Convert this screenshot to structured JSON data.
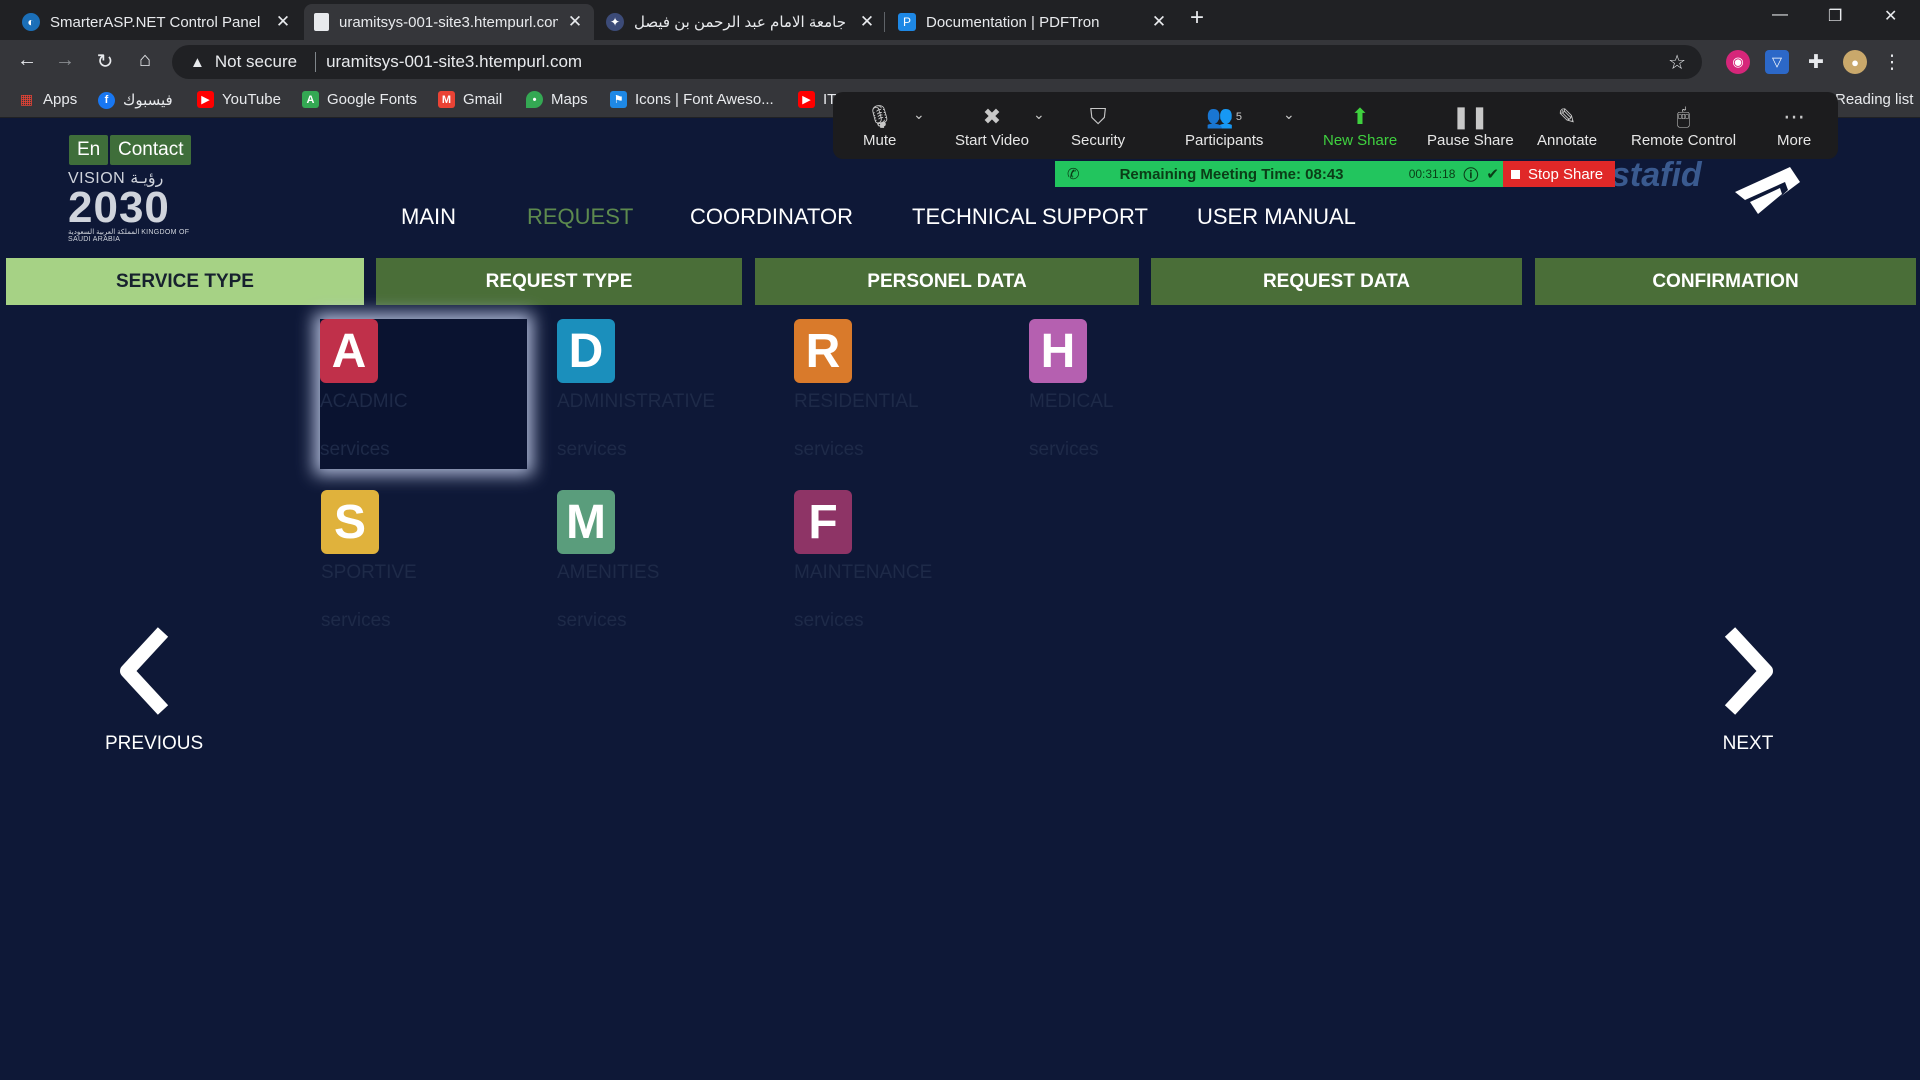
{
  "browser": {
    "tabs": [
      {
        "title": "SmarterASP.NET Control Panel",
        "active": false
      },
      {
        "title": "uramitsys-001-site3.htempurl.com",
        "active": true
      },
      {
        "title": "جامعة الامام عبد الرحمن بن فيصل",
        "active": false
      },
      {
        "title": "Documentation | PDFTron",
        "active": false
      }
    ],
    "address": {
      "security_label": "Not secure",
      "url": "uramitsys-001-site3.htempurl.com"
    },
    "bookmarks": [
      "Apps",
      "فيسبوك",
      "YouTube",
      "Google Fonts",
      "Gmail",
      "Maps",
      "Icons | Font Aweso...",
      "IT"
    ],
    "reading_list": "Reading list"
  },
  "zoom": {
    "controls": [
      "Mute",
      "Start Video",
      "Security",
      "Participants",
      "New Share",
      "Pause Share",
      "Annotate",
      "Remote Control",
      "More"
    ],
    "participants_count": "5",
    "meeting_time": "Remaining Meeting Time: 08:43",
    "elapsed": "00:31:18",
    "stop_share": "Stop Share"
  },
  "header": {
    "lang": "En",
    "contact": "Contact",
    "vision_top": "VISION رؤيـة",
    "vision_year": "2030",
    "vision_sub": "المملكة العربية السعودية KINGDOM OF SAUDI ARABIA",
    "brand": "mustafid",
    "nav": [
      "MAIN",
      "REQUEST",
      "COORDINATOR",
      "TECHNICAL SUPPORT",
      "USER MANUAL"
    ],
    "nav_active": "REQUEST"
  },
  "steps": [
    "SERVICE TYPE",
    "REQUEST TYPE",
    "PERSONEL DATA",
    "REQUEST DATA",
    "CONFIRMATION"
  ],
  "services": [
    {
      "letter": "A",
      "name": "ACADMIC",
      "sub": "services",
      "color": "#c0304a"
    },
    {
      "letter": "D",
      "name": "ADMINISTRATIVE",
      "sub": "services",
      "color": "#1b8fbc"
    },
    {
      "letter": "R",
      "name": "RESIDENTIAL",
      "sub": "services",
      "color": "#d97a2b"
    },
    {
      "letter": "H",
      "name": "MEDICAL",
      "sub": "services",
      "color": "#b560b0"
    },
    {
      "letter": "S",
      "name": "SPORTIVE",
      "sub": "services",
      "color": "#e0b23c"
    },
    {
      "letter": "M",
      "name": "AMENITIES",
      "sub": "services",
      "color": "#5a9d7c"
    },
    {
      "letter": "F",
      "name": "MAINTENANCE",
      "sub": "services",
      "color": "#8e3466"
    }
  ],
  "nav_arrows": {
    "previous": "PREVIOUS",
    "next": "NEXT"
  }
}
